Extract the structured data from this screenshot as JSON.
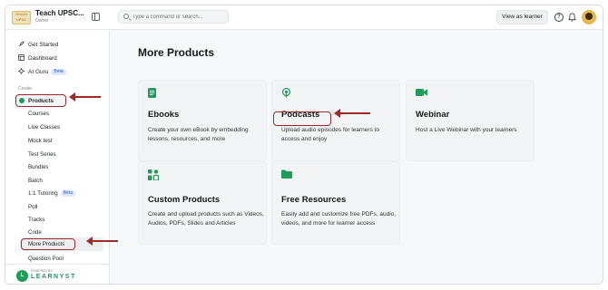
{
  "app": {
    "brand_logo_text": "TEACH UPSC",
    "brand_name": "Teach UPSC...",
    "brand_role": "Owner"
  },
  "topbar": {
    "search_placeholder": "Type a command or search...",
    "view_as_learner": "View as learner",
    "help_glyph": "?"
  },
  "sidebar": {
    "primary": [
      {
        "label": "Get Started",
        "icon": "rocket-icon"
      },
      {
        "label": "Dashboard",
        "icon": "dashboard-icon"
      },
      {
        "label": "AI Guru",
        "icon": "sparkle-icon",
        "badge": "Beta"
      }
    ],
    "section_label": "Create",
    "products_label": "Products",
    "sub_items": [
      {
        "label": "Courses"
      },
      {
        "label": "Live Classes"
      },
      {
        "label": "Mock test"
      },
      {
        "label": "Test Series"
      },
      {
        "label": "Bundles"
      },
      {
        "label": "Batch"
      },
      {
        "label": "1:1 Tutoring",
        "badge": "Beta"
      },
      {
        "label": "Poll"
      },
      {
        "label": "Tracks"
      },
      {
        "label": "Code"
      }
    ],
    "more_products_label": "More Products",
    "question_pool_label": "Question Pool",
    "powered_by": "POWERED BY",
    "footer_brand": "LEARNYST",
    "footer_mark": "L"
  },
  "main": {
    "title": "More Products",
    "cards": [
      {
        "title": "Ebooks",
        "desc": "Create your own eBook by embedding lessons, resources, and more",
        "icon": "ebook-icon"
      },
      {
        "title": "Podcasts",
        "desc": "Upload audio episodes for learners to access and enjoy",
        "icon": "podcast-icon"
      },
      {
        "title": "Webinar",
        "desc": "Host a Live Webinar with your learners",
        "icon": "video-icon"
      },
      {
        "title": "Custom Products",
        "desc": "Create and upload products such as Videos, Audios, PDFs, Slides and Articles",
        "icon": "custom-product-icon"
      },
      {
        "title": "Free Resources",
        "desc": "Easily add and customize free PDFs, audio, videos, and more for learner access",
        "icon": "folder-icon"
      }
    ]
  },
  "colors": {
    "accent_green": "#1f9b5a",
    "annotation_red": "#9c2c2c",
    "beta_blue": "#3a62b8"
  }
}
